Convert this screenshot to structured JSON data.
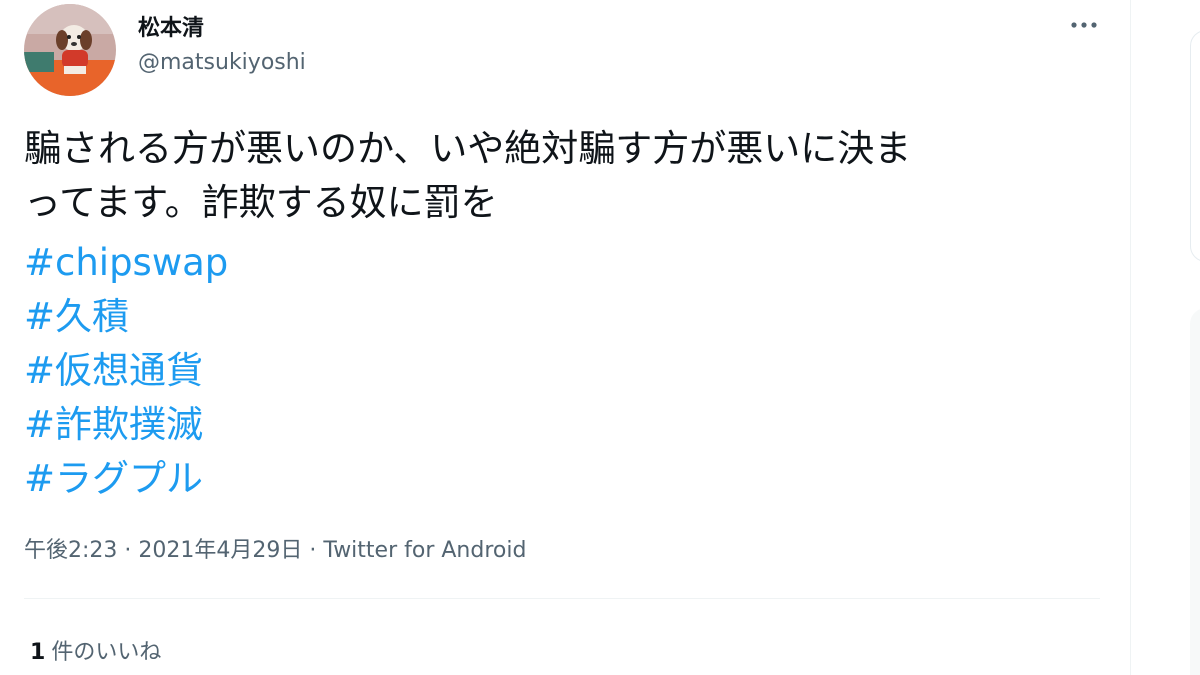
{
  "tweet": {
    "author": {
      "display_name": "松本清",
      "handle": "@matsukiyoshi"
    },
    "more_icon": "more-horizontal-icon",
    "text_lines": [
      "騙される方が悪いのか、いや絶対騙す方が悪いに決ま",
      "ってます。詐欺する奴に罰を"
    ],
    "hashtags": [
      "#chipswap",
      "#久積",
      "#仮想通貨",
      "#詐欺撲滅",
      "#ラグプル"
    ],
    "meta": {
      "time": "午後2:23",
      "separator": "·",
      "date": "2021年4月29日",
      "source": "Twitter for Android"
    },
    "likes": {
      "count": "1",
      "label": "件のいいね"
    }
  },
  "colors": {
    "text_primary": "#0f1419",
    "text_secondary": "#536471",
    "link": "#1d9bf0",
    "divider": "#eff3f4"
  }
}
